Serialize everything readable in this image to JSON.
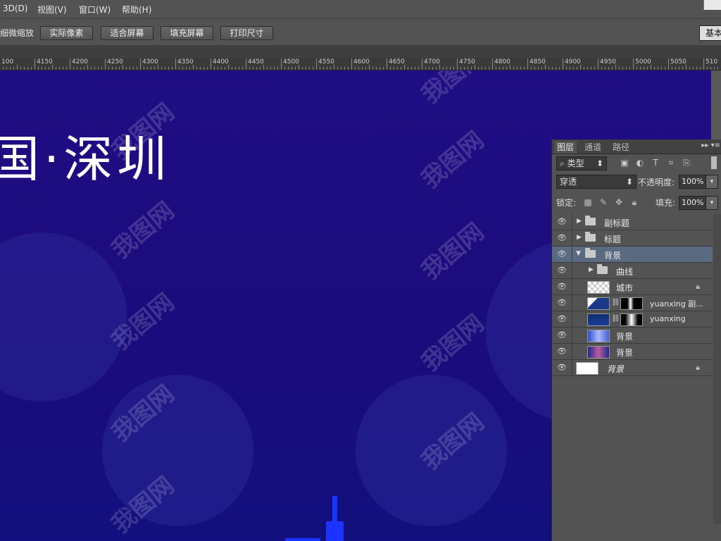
{
  "menu": {
    "items": [
      "3D(D)",
      "视图(V)",
      "窗口(W)",
      "帮助(H)"
    ]
  },
  "options": {
    "zoom_label": "细微缩放",
    "buttons": [
      "实际像素",
      "适合屏幕",
      "填充屏幕",
      "打印尺寸"
    ],
    "workspace": "基本"
  },
  "ruler": {
    "ticks": [
      "100",
      "4150",
      "4200",
      "4250",
      "4300",
      "4350",
      "4400",
      "4450",
      "4500",
      "4550",
      "4600",
      "4650",
      "4700",
      "4750",
      "4800",
      "4850",
      "4900",
      "4950",
      "5000",
      "5050",
      "510"
    ]
  },
  "canvas": {
    "title": "国·深圳"
  },
  "watermark": {
    "text": "我图网"
  },
  "colors": {
    "canvas_bg": "#1d0d80",
    "tower": "#1a33ff",
    "selected_layer": "#5a6a80"
  },
  "layers_panel": {
    "tabs": [
      "图层",
      "通道",
      "路径"
    ],
    "kind_filter": "类型",
    "blend_mode": "穿透",
    "opacity_label": "不透明度:",
    "opacity_value": "100%",
    "lock_label": "锁定:",
    "fill_label": "填充:",
    "fill_value": "100%",
    "layers": [
      {
        "name": "副标题",
        "type": "group",
        "expanded": false
      },
      {
        "name": "标题",
        "type": "group",
        "expanded": false
      },
      {
        "name": "背景",
        "type": "group",
        "expanded": true,
        "selected": true
      },
      {
        "name": "曲线",
        "type": "group",
        "expanded": false
      },
      {
        "name": "城市",
        "type": "layer",
        "locked": true
      },
      {
        "name": "yuanxing 副...",
        "type": "masked-layer"
      },
      {
        "name": "yuanxing",
        "type": "masked-layer"
      },
      {
        "name": "背景",
        "type": "layer"
      },
      {
        "name": "背景",
        "type": "layer"
      },
      {
        "name": "背景",
        "type": "background",
        "locked": true
      }
    ]
  }
}
